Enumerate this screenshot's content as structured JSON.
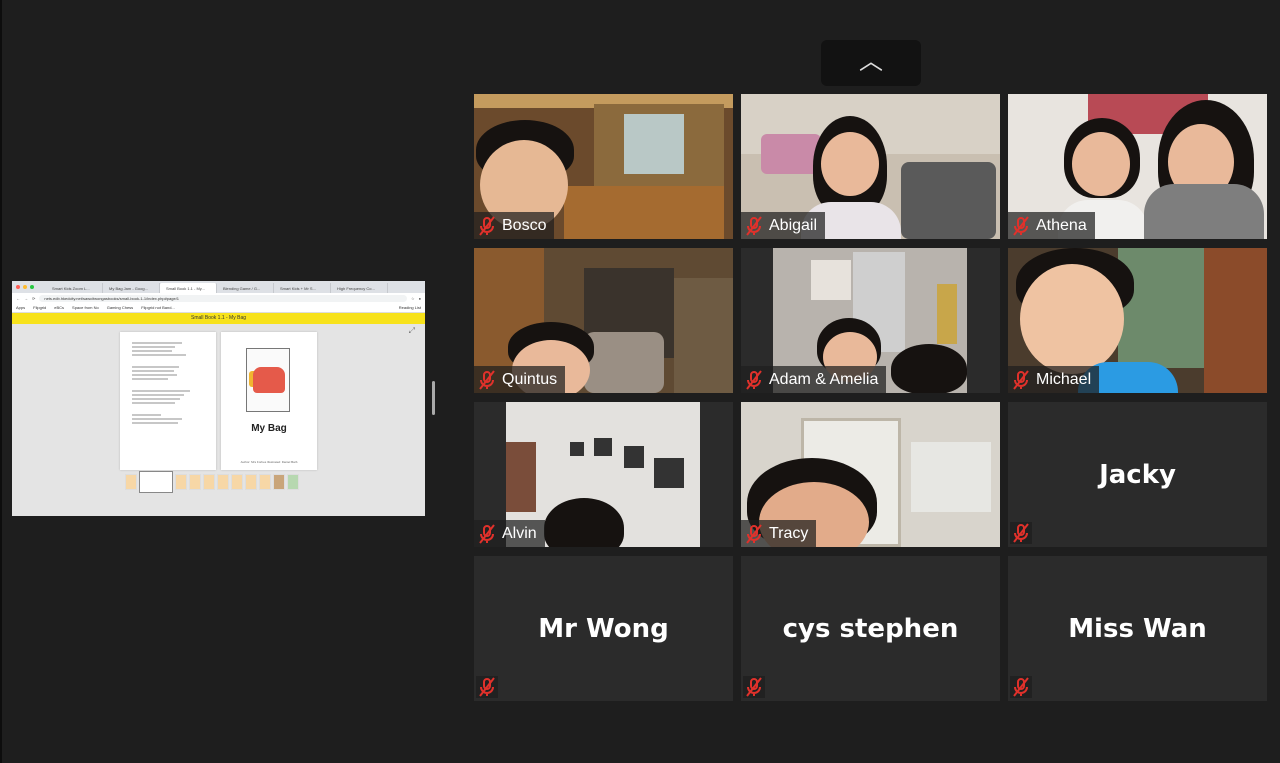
{
  "shared_screen": {
    "browser_tabs": [
      "Smart Kids Zoom L...",
      "My Bag Jam - Goog...",
      "Small Book 1.1 - My...",
      "Blending Game / G...",
      "Smart Kids + Mr S...",
      "High Frequency Co..."
    ],
    "url": "nets.edb.hkedcity.net/sawcitwongasbooks/small-book-1-1/index.php#page/1",
    "bookmarks": [
      "Apps",
      "Flipgrid",
      "eBCs",
      "Space from No",
      "Gaming Chess",
      "Flipgrid not Band..."
    ],
    "reading_list": "Reading List",
    "book_header": "Small Book 1.1 - My Bag",
    "book_title": "My Bag",
    "credits": "Author: Mrs Forbes  Illustrated: Daniel Barb"
  },
  "collapse_button_icon": "chevron-up-icon",
  "participants": [
    {
      "name": "Bosco",
      "video": true,
      "muted": true
    },
    {
      "name": "Abigail",
      "video": true,
      "muted": true
    },
    {
      "name": "Athena",
      "video": true,
      "muted": true
    },
    {
      "name": "Quintus",
      "video": true,
      "muted": true
    },
    {
      "name": "Adam & Amelia",
      "video": true,
      "muted": true
    },
    {
      "name": "Michael",
      "video": true,
      "muted": true
    },
    {
      "name": "Alvin",
      "video": true,
      "muted": true
    },
    {
      "name": "Tracy",
      "video": true,
      "muted": true
    },
    {
      "name": "Jacky",
      "video": false,
      "muted": true
    },
    {
      "name": "Mr Wong",
      "video": false,
      "muted": true
    },
    {
      "name": "cys stephen",
      "video": false,
      "muted": true
    },
    {
      "name": "Miss Wan",
      "video": false,
      "muted": true
    }
  ],
  "colors": {
    "mute_red": "#e0312b",
    "background": "#1e1e1e",
    "tile": "#2b2b2b",
    "book_yellow": "#f7e21b"
  }
}
